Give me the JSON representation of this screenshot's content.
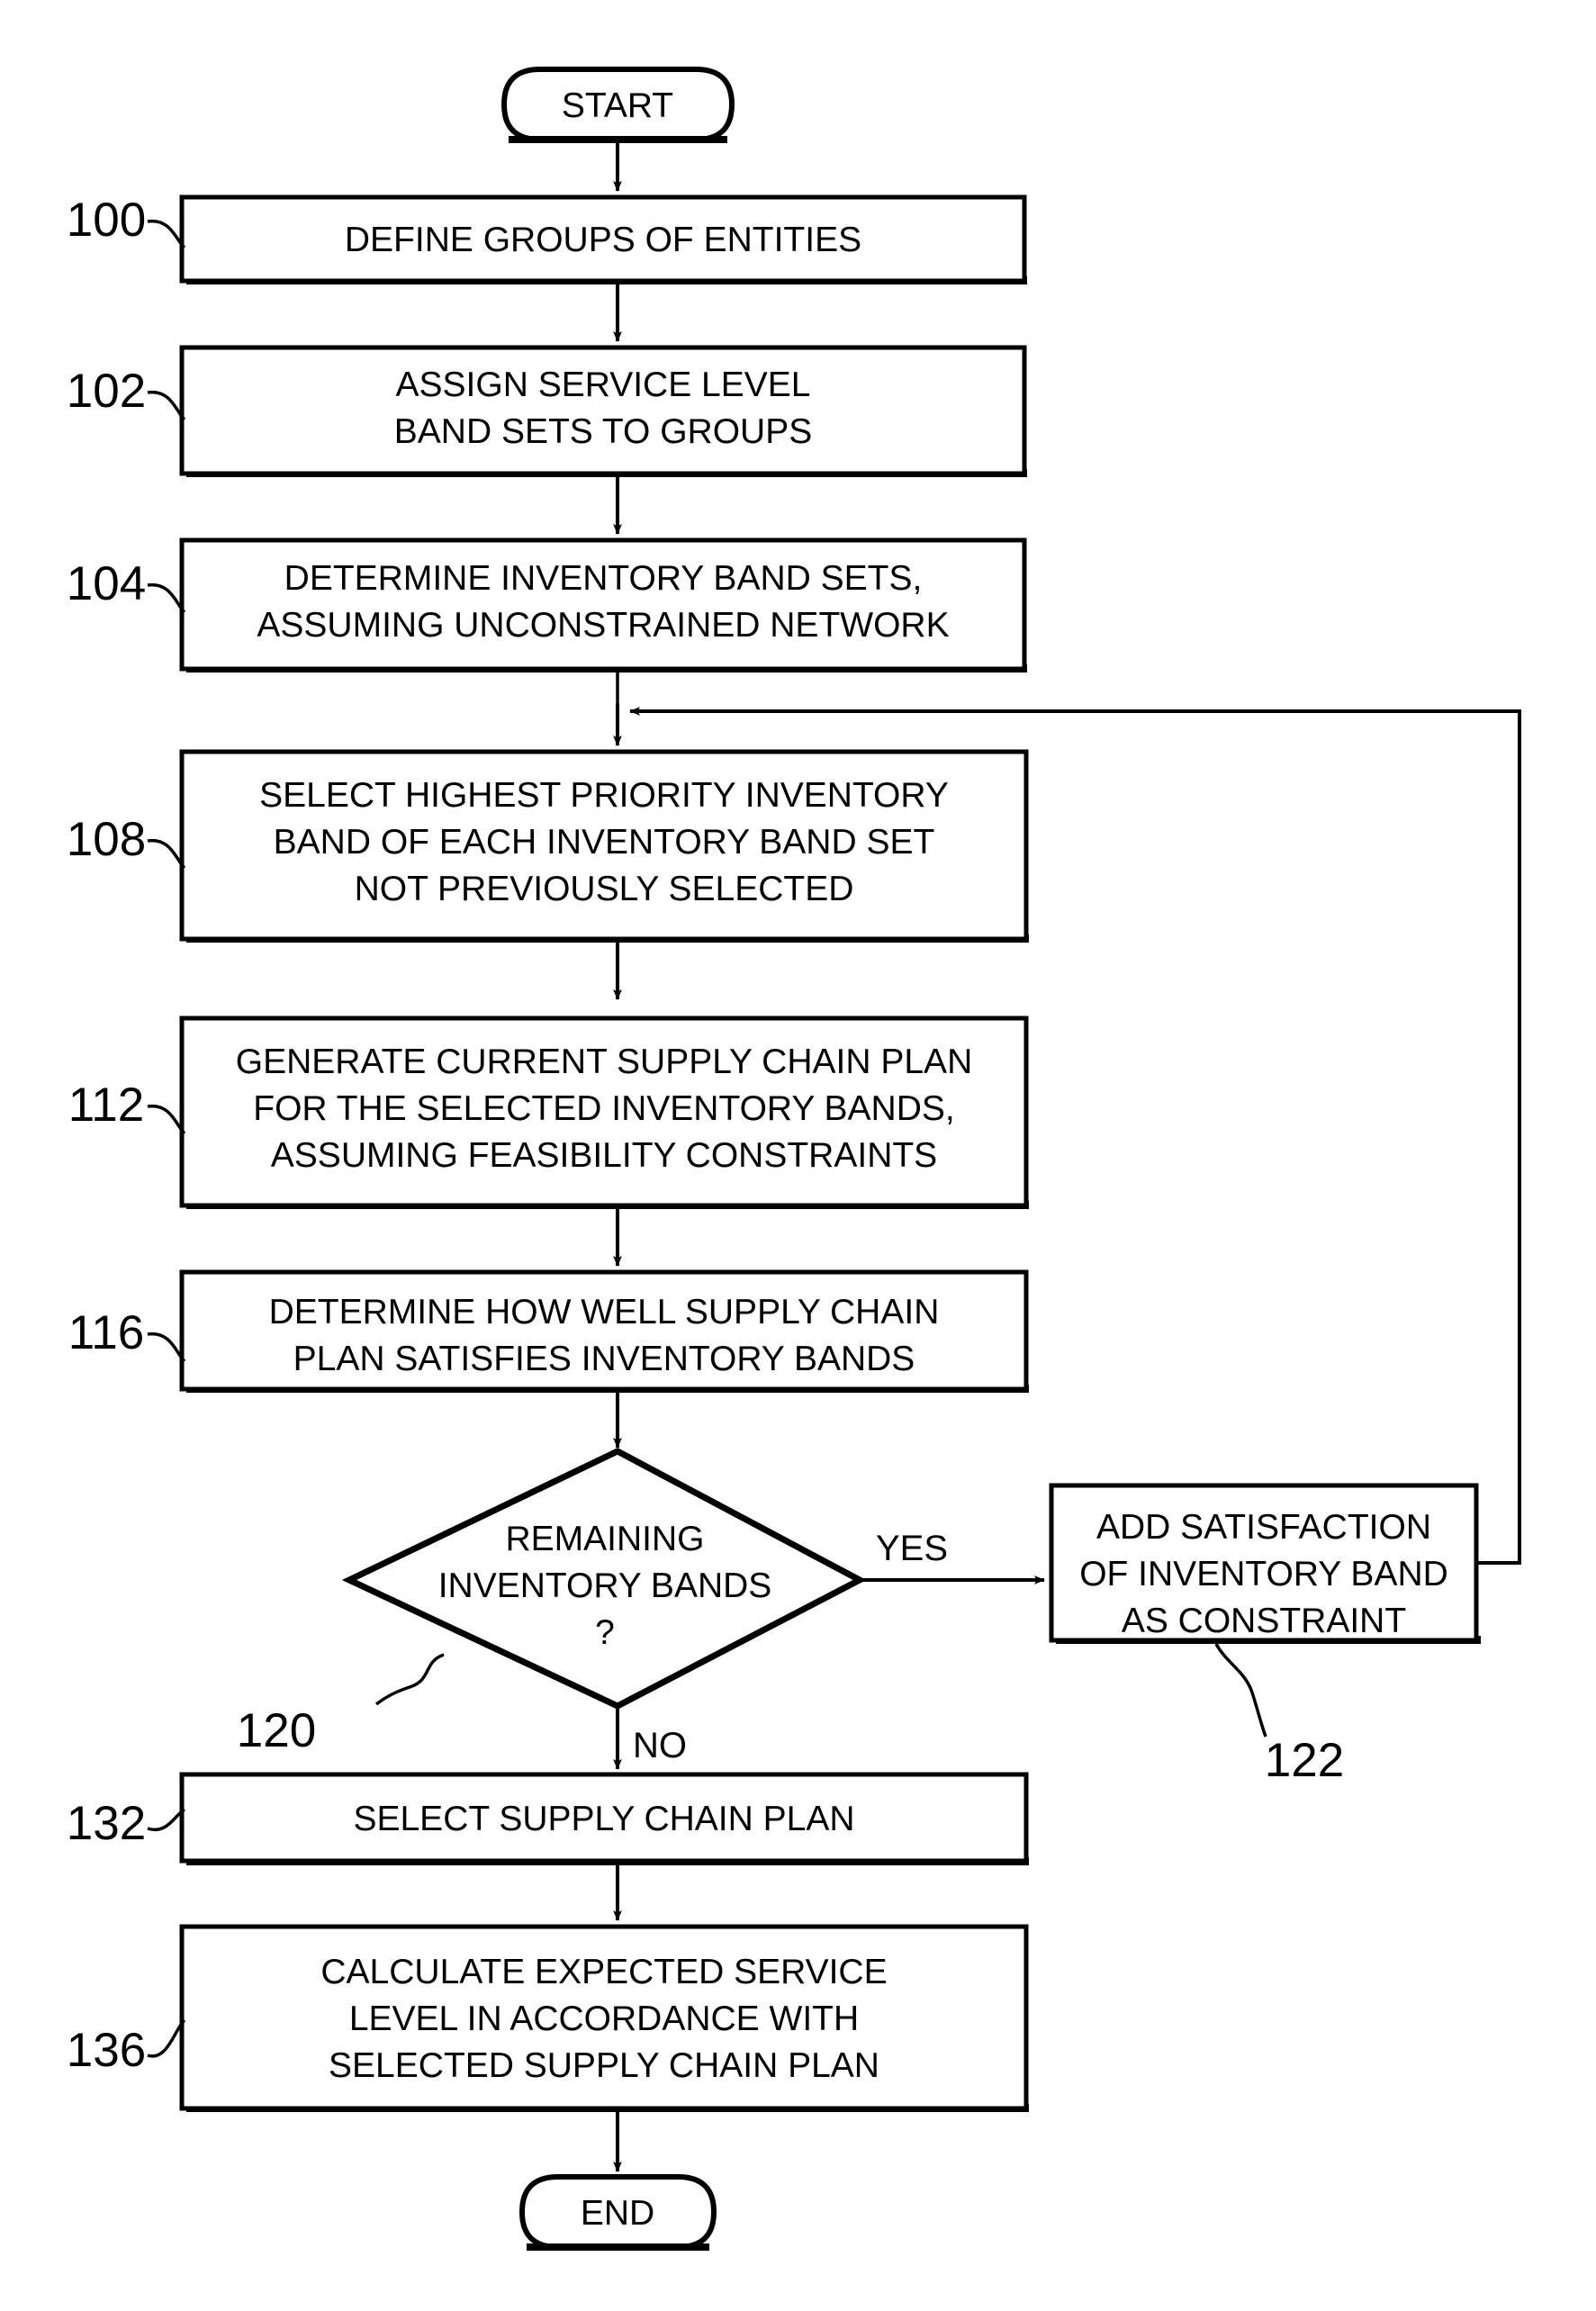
{
  "figure": {
    "type": "flowchart",
    "orientation": "vertical",
    "background_color": "#ffffff",
    "line_color": "#000000"
  },
  "terminators": {
    "start": {
      "label": "START"
    },
    "end": {
      "label": "END"
    }
  },
  "nodes": [
    {
      "ref": "100",
      "shape": "process",
      "lines": [
        "DEFINE GROUPS OF ENTITIES"
      ]
    },
    {
      "ref": "102",
      "shape": "process",
      "lines": [
        "ASSIGN SERVICE LEVEL",
        "BAND SETS TO GROUPS"
      ]
    },
    {
      "ref": "104",
      "shape": "process",
      "lines": [
        "DETERMINE INVENTORY BAND SETS,",
        "ASSUMING UNCONSTRAINED NETWORK"
      ]
    },
    {
      "ref": "108",
      "shape": "process",
      "lines": [
        "SELECT HIGHEST PRIORITY INVENTORY",
        "BAND OF EACH INVENTORY BAND SET",
        "NOT PREVIOUSLY SELECTED"
      ]
    },
    {
      "ref": "112",
      "shape": "process",
      "lines": [
        "GENERATE CURRENT SUPPLY CHAIN PLAN",
        "FOR THE SELECTED INVENTORY BANDS,",
        "ASSUMING FEASIBILITY CONSTRAINTS"
      ]
    },
    {
      "ref": "116",
      "shape": "process",
      "lines": [
        "DETERMINE HOW WELL SUPPLY CHAIN",
        "PLAN SATISFIES INVENTORY BANDS"
      ]
    },
    {
      "ref": "120",
      "shape": "decision",
      "lines": [
        "REMAINING",
        "INVENTORY BANDS",
        "?"
      ]
    },
    {
      "ref": "122",
      "shape": "process",
      "lines": [
        "ADD SATISFACTION",
        "OF INVENTORY BAND",
        "AS CONSTRAINT"
      ]
    },
    {
      "ref": "132",
      "shape": "process",
      "lines": [
        "SELECT SUPPLY CHAIN PLAN"
      ]
    },
    {
      "ref": "136",
      "shape": "process",
      "lines": [
        "CALCULATE EXPECTED SERVICE",
        "LEVEL IN ACCORDANCE WITH",
        "SELECTED SUPPLY CHAIN PLAN"
      ]
    }
  ],
  "edge_labels": {
    "yes": "YES",
    "no": "NO"
  }
}
